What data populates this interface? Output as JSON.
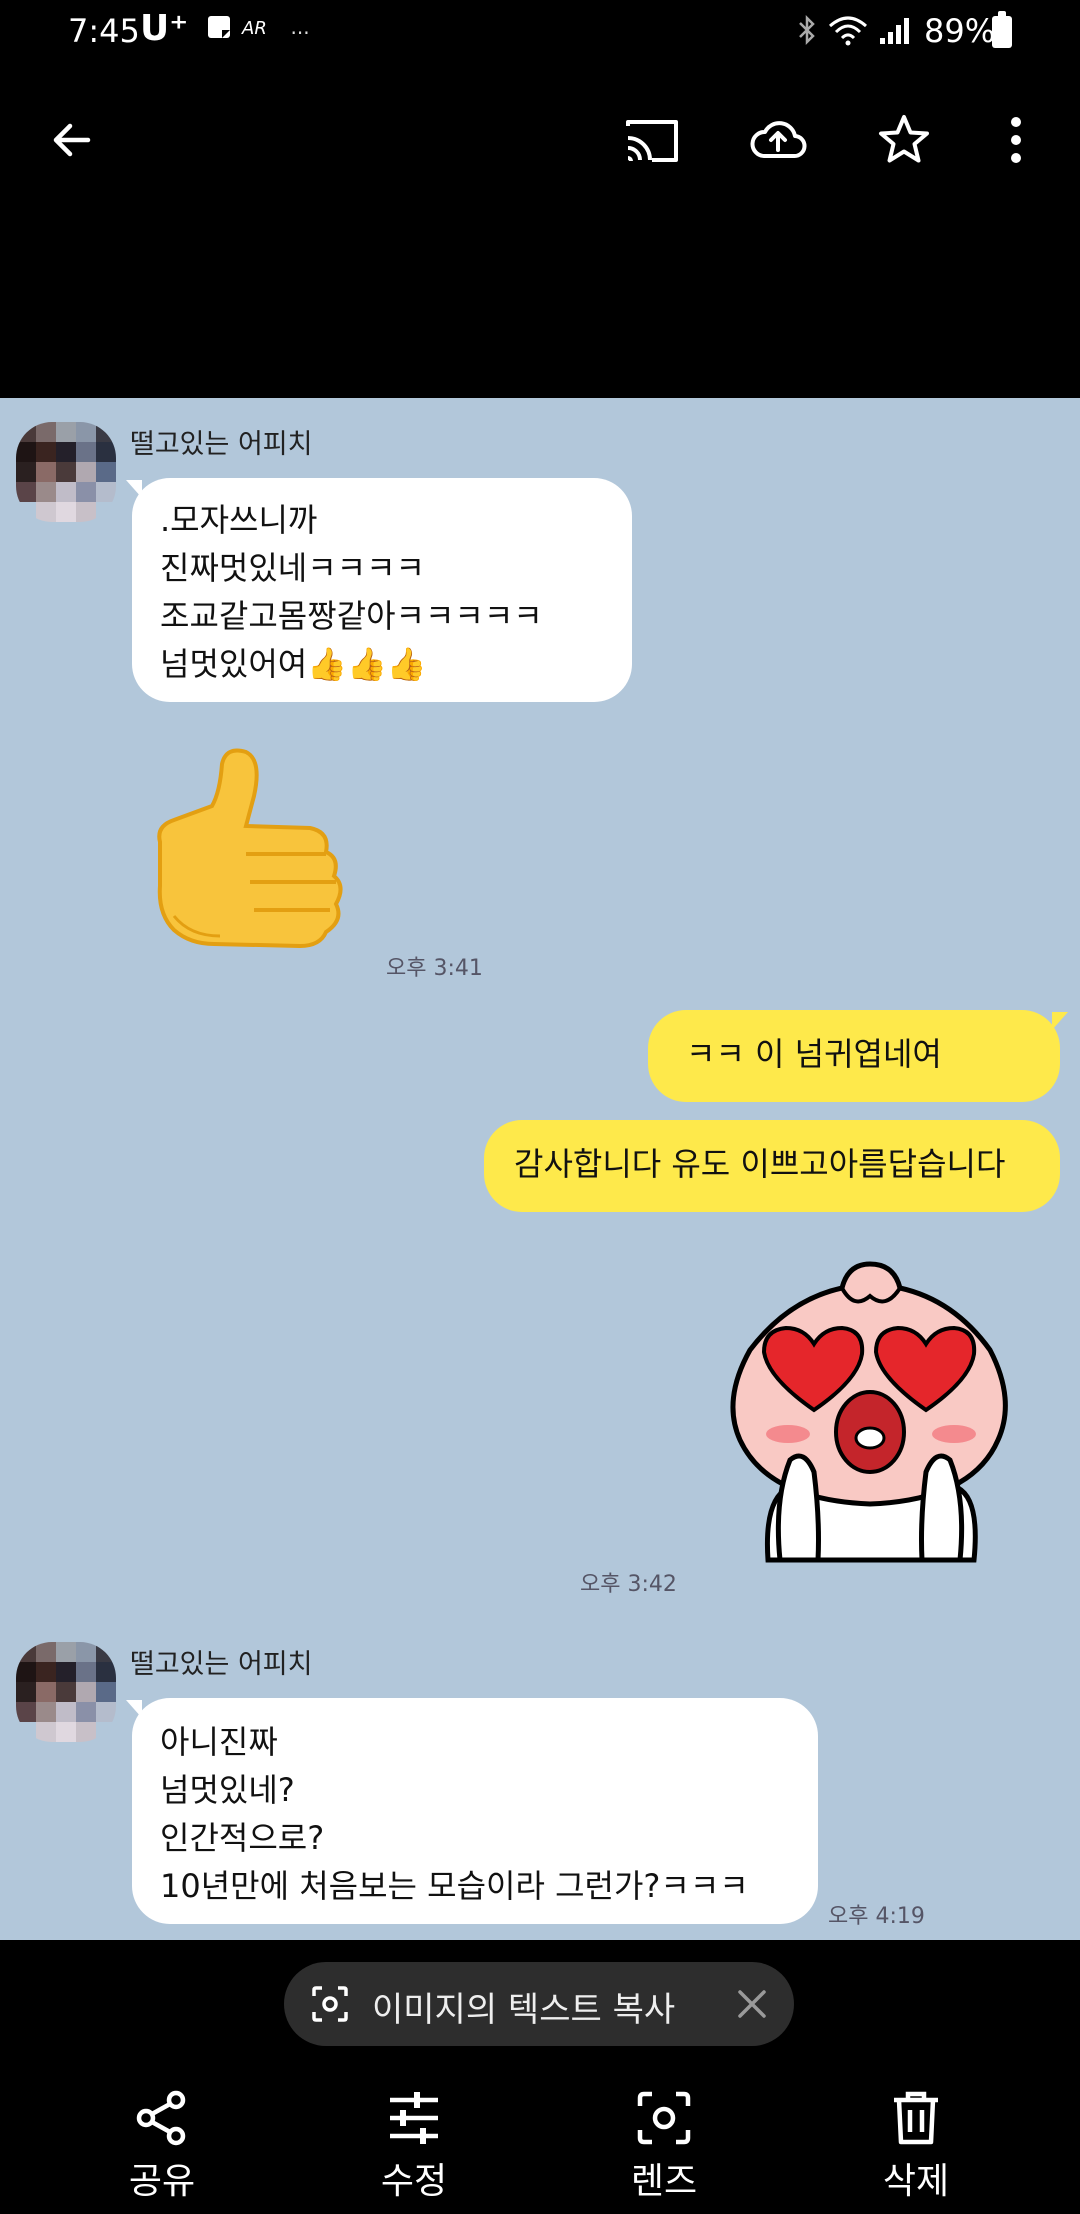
{
  "status_bar": {
    "time": "7:45",
    "carrier": "U⁺",
    "extra": "···",
    "battery": "89%"
  },
  "toolbar": {
    "icons": [
      "back-arrow-icon",
      "cast-icon",
      "cloud-upload-icon",
      "star-icon",
      "more-vert-icon"
    ]
  },
  "chat": {
    "sender_1": "떨고있는 어피치",
    "message_1": [
      ".모자쓰니까",
      "진짜멋있네ㅋㅋㅋㅋ",
      "조교같고몸짱같아ㅋㅋㅋㅋㅋ",
      "넘멋있어여👍👍👍"
    ],
    "time_1": "오후 3:41",
    "reply_1": "ㅋㅋ       이 넘귀엽네여",
    "reply_2": "감사합니다 유도 이쁘고아름답습니다",
    "time_2": "오후 3:42",
    "sender_2": "떨고있는 어피치",
    "message_2": [
      "아니진짜",
      "넘멋있네?",
      "인간적으로?",
      "10년만에 처음보는 모습이라 그런가?ㅋㅋㅋ"
    ],
    "time_3": "오후 4:19"
  },
  "lens_chip": {
    "label": "이미지의 텍스트 복사"
  },
  "bottom_bar": {
    "share": "공유",
    "edit": "수정",
    "lens": "렌즈",
    "delete": "삭제"
  },
  "colors": {
    "chat_background": "#b2c7da",
    "my_bubble": "#fee94b",
    "their_bubble": "#ffffff"
  }
}
